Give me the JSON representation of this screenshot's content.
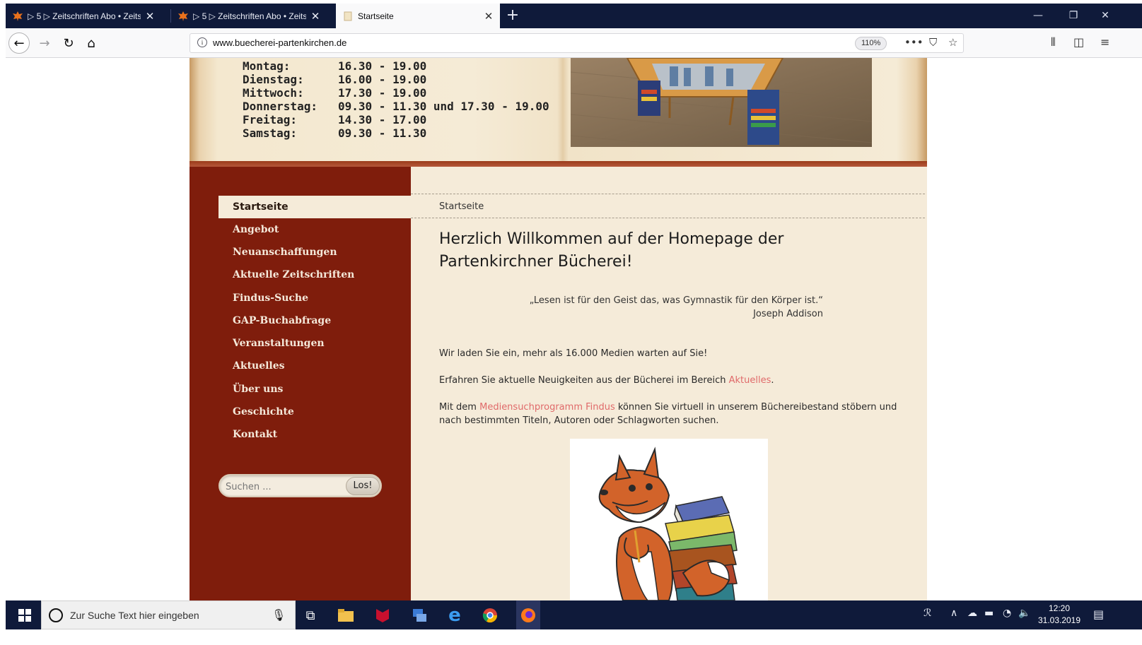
{
  "browser": {
    "tabs": [
      {
        "label": "▷ 5 ▷ Zeitschriften Abo • Zeits",
        "active": false
      },
      {
        "label": "▷ 5 ▷ Zeitschriften Abo • Zeits",
        "active": false
      },
      {
        "label": "Startseite",
        "active": true
      }
    ],
    "url": "www.buecherei-partenkirchen.de",
    "zoom": "110%"
  },
  "header": {
    "opening_hours": [
      {
        "day": "Montag:",
        "time": "16.30 - 19.00"
      },
      {
        "day": "Dienstag:",
        "time": "16.00 - 19.00"
      },
      {
        "day": "Mittwoch:",
        "time": "17.30 - 19.00"
      },
      {
        "day": "Donnerstag:",
        "time": "09.30 - 11.30 und 17.30 - 19.00"
      },
      {
        "day": "Freitag:",
        "time": "14.30 - 17.00"
      },
      {
        "day": "Samstag:",
        "time": "09.30 - 11.30"
      }
    ]
  },
  "sidebar": {
    "menu": [
      {
        "label": "Startseite",
        "active": true
      },
      {
        "label": "Angebot"
      },
      {
        "label": "Neuanschaffungen"
      },
      {
        "label": "Aktuelle Zeitschriften"
      },
      {
        "label": "Findus-Suche"
      },
      {
        "label": "GAP-Buchabfrage"
      },
      {
        "label": "Veranstaltungen"
      },
      {
        "label": "Aktuelles"
      },
      {
        "label": "Über uns"
      },
      {
        "label": "Geschichte"
      },
      {
        "label": "Kontakt"
      }
    ],
    "search": {
      "placeholder": "Suchen ...",
      "button": "Los!"
    }
  },
  "main": {
    "breadcrumb": "Startseite",
    "heading": "Herzlich Willkommen auf der Homepage der Partenkirchner Bücherei!",
    "quote": "„Lesen ist für den Geist das, was Gymnastik für den Körper ist.“",
    "quote_author": "Joseph Addison",
    "p1": "Wir laden Sie ein, mehr als 16.000 Medien warten auf Sie!",
    "p2_before": "Erfahren Sie aktuelle Neuigkeiten aus der Bücherei im Bereich ",
    "p2_link": "Aktuelles",
    "p2_after": ".",
    "p3_before": "Mit dem ",
    "p3_link": "Mediensuchprogramm Findus",
    "p3_after": " können Sie virtuell in unserem Büchereibestand stöbern und nach bestimmten Titeln, Autoren oder Schlagworten suchen."
  },
  "taskbar": {
    "search_text": "Zur Suche Text hier eingeben",
    "time": "12:20",
    "date": "31.03.2019"
  },
  "colors": {
    "sidebar": "#7f1d0c",
    "content_bg": "#f5ebd9",
    "link": "#e06a6a",
    "chrome_dark": "#0f1a3a"
  }
}
